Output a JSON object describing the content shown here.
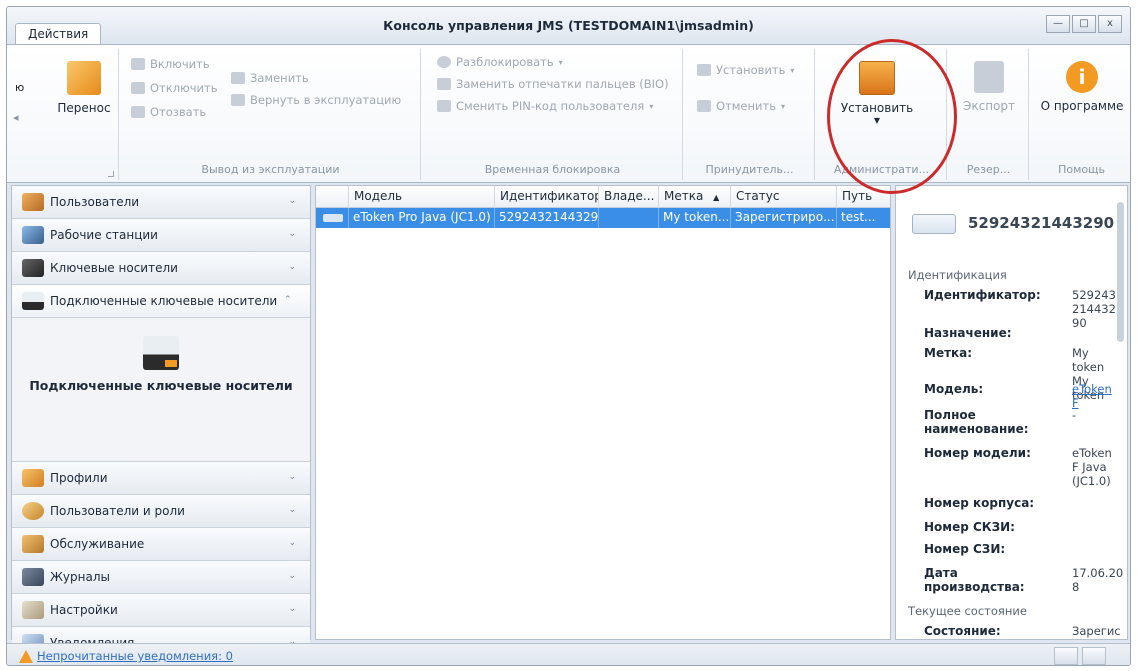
{
  "window": {
    "title": "Консоль управления JMS (TESTDOMAIN1\\jmsadmin)",
    "buttons": {
      "minimize": "—",
      "maximize": "□",
      "close": "x"
    }
  },
  "ribbon": {
    "tab_label": "Действия",
    "left_partial": "ю",
    "transfer_label": "Перенос",
    "group_decommission": {
      "label": "Вывод из эксплуатации",
      "enable": "Включить",
      "disable": "Отключить",
      "revoke": "Отозвать",
      "replace": "Заменить",
      "return": "Вернуть в эксплуатацию"
    },
    "group_lock": {
      "label": "Временная блокировка",
      "unlock": "Разблокировать",
      "replace_bio": "Заменить отпечатки пальцев (BIO)",
      "change_pin": "Сменить PIN-код пользователя"
    },
    "group_force": {
      "label": "Принудитель...",
      "install": "Установить",
      "cancel": "Отменить"
    },
    "group_admin": {
      "label": "Администрати...",
      "install": "Установить"
    },
    "group_backup": {
      "label": "Резер...",
      "export": "Экспорт"
    },
    "group_help": {
      "label": "Помощь",
      "about": "О программе"
    }
  },
  "sidebar": {
    "items": [
      {
        "label": "Пользователи",
        "chevron": "⌄"
      },
      {
        "label": "Рабочие станции",
        "chevron": "⌄"
      },
      {
        "label": "Ключевые носители",
        "chevron": "⌄"
      },
      {
        "label": "Подключенные ключевые носители",
        "chevron": "⌃"
      },
      {
        "label": "Профили",
        "chevron": "⌄"
      },
      {
        "label": "Пользователи и роли",
        "chevron": "⌄"
      },
      {
        "label": "Обслуживание",
        "chevron": "⌄"
      },
      {
        "label": "Журналы",
        "chevron": "⌄"
      },
      {
        "label": "Настройки",
        "chevron": "⌄"
      },
      {
        "label": "Уведомления",
        "chevron": "⌄"
      }
    ],
    "panel_text": "Подключенные ключевые носители"
  },
  "table": {
    "columns": [
      "Модель",
      "Идентификатор",
      "Владе...",
      "Метка",
      "Статус",
      "Путь"
    ],
    "sort_indicator": "▲",
    "rows": [
      {
        "model": "eToken Pro Java (JC1.0)",
        "id": "52924321443290",
        "owner": "",
        "label": "My token...",
        "status": "Зарегистриро...",
        "path": "test..."
      }
    ]
  },
  "details": {
    "header_id": "52924321443290",
    "section_identification": "Идентификация",
    "fields": [
      {
        "label": "Идентификатор:",
        "value": "52924321443290"
      },
      {
        "label": "Назначение:",
        "value": ""
      },
      {
        "label": "Метка:",
        "value": "My token My token"
      },
      {
        "label": "Модель:",
        "value": "eToken F"
      },
      {
        "label": "Полное наименование:",
        "value": "-"
      },
      {
        "label": "Номер модели:",
        "value": "eToken F Java (JC1.0)"
      },
      {
        "label": "Номер корпуса:",
        "value": ""
      },
      {
        "label": "Номер СКЗИ:",
        "value": ""
      },
      {
        "label": "Номер СЗИ:",
        "value": ""
      },
      {
        "label": "Дата производства:",
        "value": "17.06.20 8"
      }
    ],
    "section_state": "Текущее состояние",
    "state_label": "Состояние:",
    "state_value": "Зарегис"
  },
  "statusbar": {
    "notifications_link": "Непрочитанные уведомления: 0"
  },
  "colors": {
    "selection": "#3a8ee6",
    "highlight_circle": "#cc2b2b",
    "link": "#2f6fc0"
  }
}
